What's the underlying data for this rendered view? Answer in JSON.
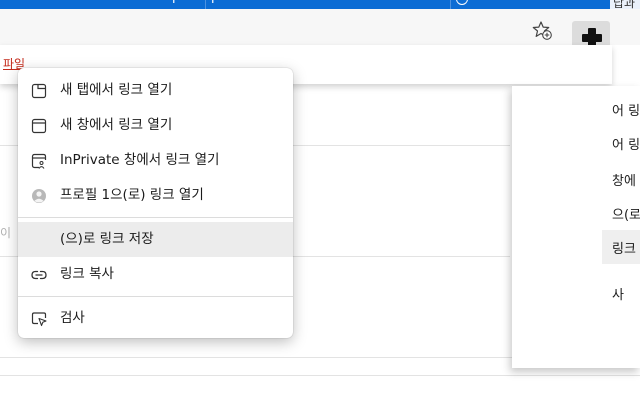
{
  "titlebar": {
    "fragments": [
      "г",
      "г",
      "답과"
    ]
  },
  "toolbar": {
    "favorite_button_icon": "star-add-icon",
    "extension_button_icon": "puzzle-icon"
  },
  "page": {
    "file_link": "파일",
    "input_fragment": "이"
  },
  "side_panel": {
    "items": [
      "어 링",
      "어 링",
      "창에",
      "으(로",
      "링크 저",
      "사"
    ]
  },
  "context_menu": {
    "items": [
      {
        "label": "새 탭에서 링크 열기",
        "icon": "new-tab-icon"
      },
      {
        "label": "새 창에서 링크 열기",
        "icon": "new-window-icon"
      },
      {
        "label": "InPrivate 창에서 링크 열기",
        "icon": "inprivate-window-icon"
      },
      {
        "label": "프로필 1으(로) 링크 열기",
        "icon": "profile-avatar-icon"
      },
      {
        "label": "(으)로 링크 저장",
        "icon": ""
      },
      {
        "label": "링크 복사",
        "icon": "link-icon"
      },
      {
        "label": "검사",
        "icon": "inspect-icon"
      }
    ],
    "highlighted_item": "(으)로 링크 저장"
  }
}
